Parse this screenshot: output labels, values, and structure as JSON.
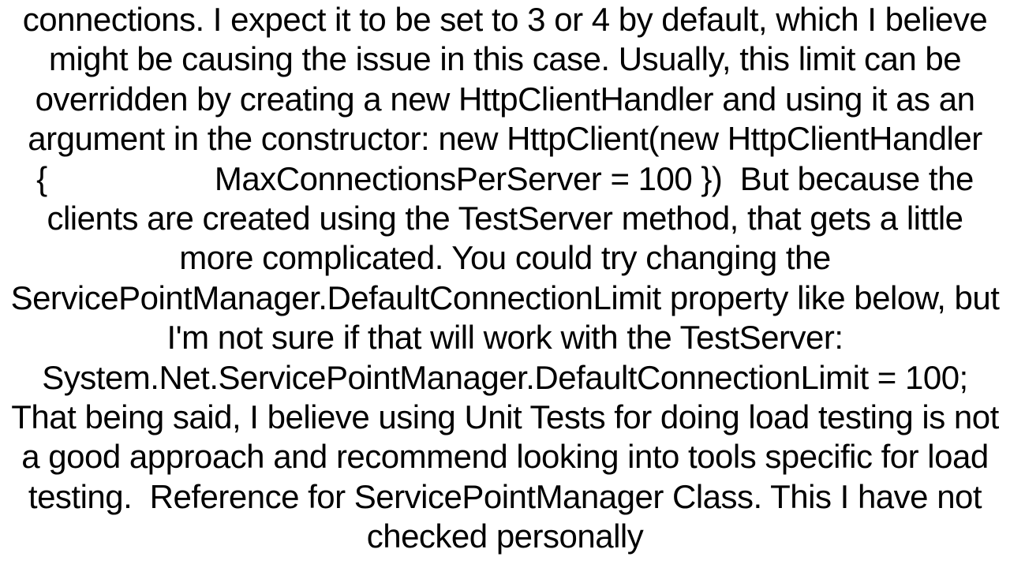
{
  "document": {
    "body_text": "connections. I expect it to be set to 3 or 4 by default, which I believe might be causing the issue in this case. Usually, this limit can be overridden by creating a new HttpClientHandler and using it as an argument in the constructor: new HttpClient(new HttpClientHandler {                   MaxConnectionsPerServer = 100 })  But because the clients are created using the TestServer method, that gets a little more complicated. You could try changing the ServicePointManager.DefaultConnectionLimit property like below, but I'm not sure if that will work with the TestServer: System.Net.ServicePointManager.DefaultConnectionLimit = 100; That being said, I believe using Unit Tests for doing load testing is not a good approach and recommend looking into tools specific for load testing.  Reference for ServicePointManager Class. This I have not checked personally"
  }
}
